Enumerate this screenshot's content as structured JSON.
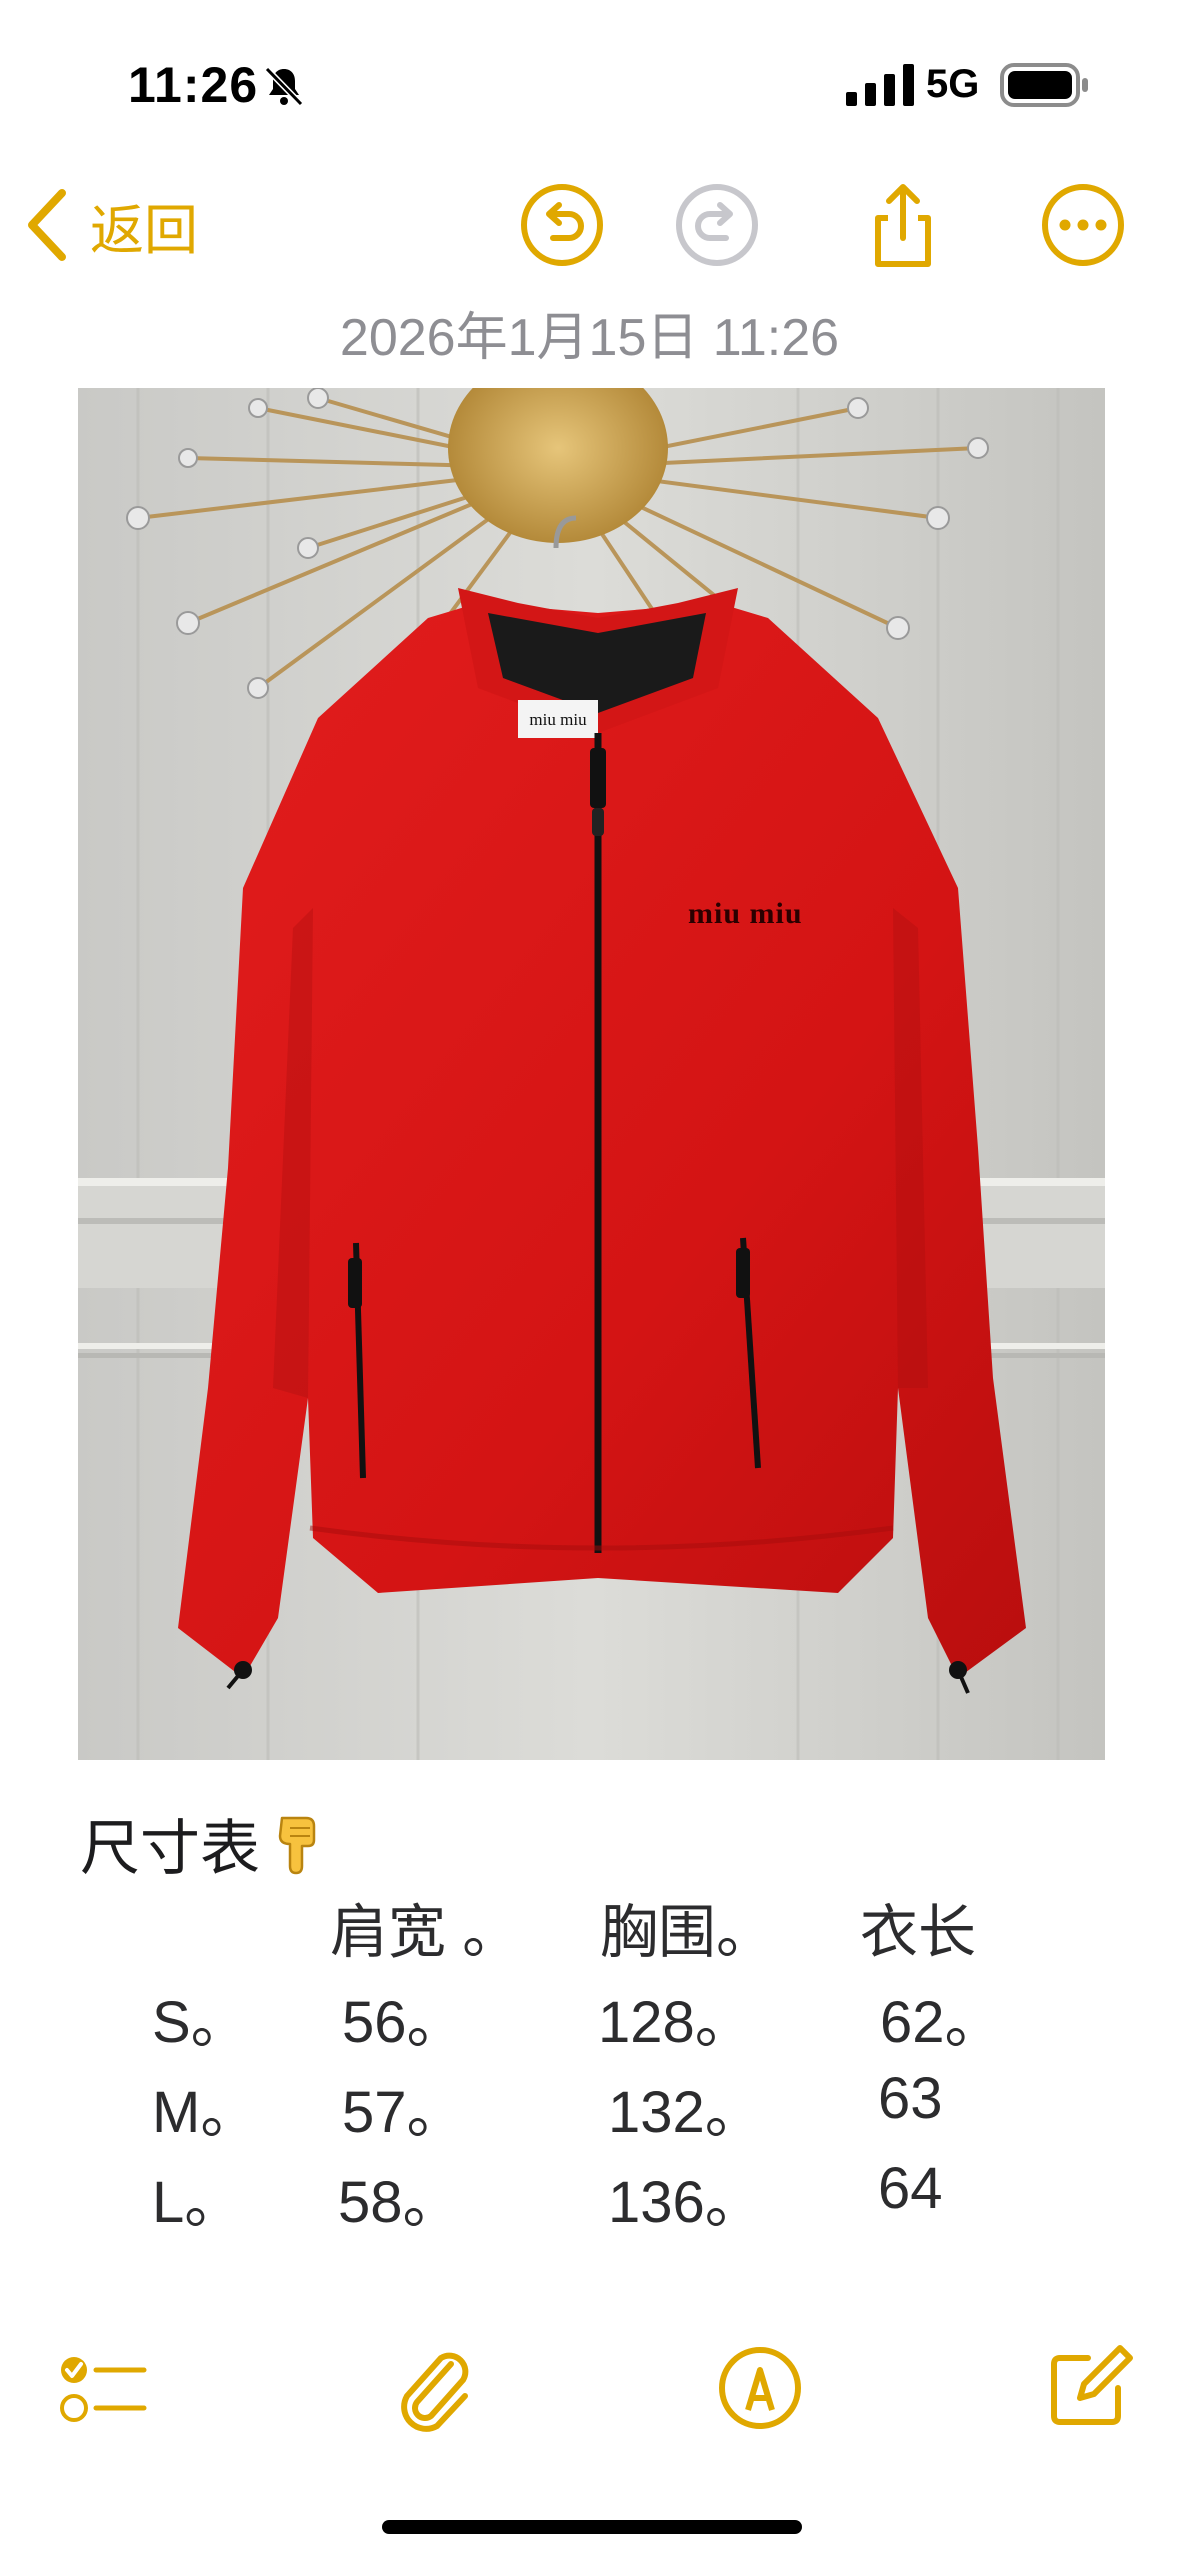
{
  "status_bar": {
    "time": "11:26",
    "network": "5G",
    "icons": [
      "bell-slash-icon",
      "signal-bars-icon",
      "battery-icon"
    ]
  },
  "nav": {
    "back_label": "返回",
    "icons": [
      "chevron-left-icon",
      "undo-icon",
      "redo-icon",
      "share-icon",
      "more-icon"
    ],
    "accent_color": "#e0a800",
    "disabled_color": "#c7c7cc"
  },
  "note": {
    "date": "2026年1月15日 11:26",
    "heading": "尺寸表",
    "heading_emoji": "pointing-down-hand",
    "size_table": {
      "headers": [
        "肩宽 。",
        "胸围。",
        "衣长"
      ],
      "rows": [
        {
          "size": "S。",
          "shoulder": "56。",
          "chest": "128。",
          "length": "62。"
        },
        {
          "size": "M。",
          "shoulder": "57。",
          "chest": "132。",
          "length": "63"
        },
        {
          "size": "L。",
          "shoulder": "58。",
          "chest": "136。",
          "length": "64"
        }
      ]
    }
  },
  "photo": {
    "brand_label": "miu miu",
    "description_icon": "red-fleece-jacket-image"
  },
  "toolbar": {
    "icons": [
      "checklist-icon",
      "paperclip-icon",
      "markup-pen-icon",
      "compose-icon"
    ]
  }
}
